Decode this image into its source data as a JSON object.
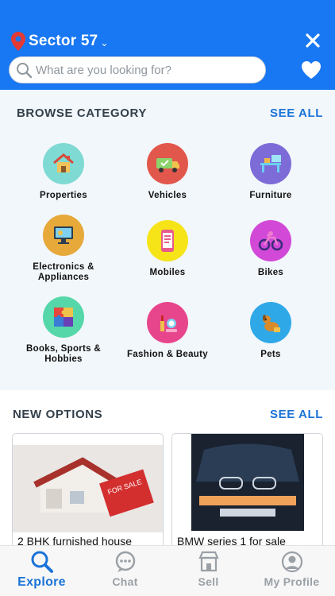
{
  "header": {
    "location": "Sector 57",
    "search_placeholder": "What are you looking for?",
    "pin_color": "#e53935",
    "bg_color": "#1877f2"
  },
  "browse": {
    "title": "BROWSE CATEGORY",
    "see_all": "SEE ALL",
    "categories": [
      {
        "label": "Properties",
        "icon": "house-icon",
        "color": "#7fdad3"
      },
      {
        "label": "Vehicles",
        "icon": "truck-icon",
        "color": "#e2574c"
      },
      {
        "label": "Furniture",
        "icon": "furniture-icon",
        "color": "#7d6bd8"
      },
      {
        "label": "Electronics &\nAppliances",
        "icon": "computer-icon",
        "color": "#e6a93a"
      },
      {
        "label": "Mobiles",
        "icon": "phone-icon",
        "color": "#f6e419"
      },
      {
        "label": "Bikes",
        "icon": "bike-icon",
        "color": "#d249d8"
      },
      {
        "label": "Books, Sports &\nHobbies",
        "icon": "puzzle-icon",
        "color": "#56d7a9"
      },
      {
        "label": "Fashion & Beauty",
        "icon": "cosmetics-icon",
        "color": "#e8468c"
      },
      {
        "label": "Pets",
        "icon": "dog-icon",
        "color": "#2fa8e8"
      }
    ]
  },
  "new_options": {
    "title": "NEW OPTIONS",
    "see_all": "SEE ALL",
    "items": [
      {
        "title": "2 BHK furnished house",
        "image": "house-for-sale-image",
        "sign_text": "FOR SALE"
      },
      {
        "title": "BMW series 1 for sale",
        "image": "bmw-car-image"
      }
    ]
  },
  "tabbar": {
    "tabs": [
      {
        "label": "Explore",
        "icon": "search-icon",
        "active": true
      },
      {
        "label": "Chat",
        "icon": "chat-icon",
        "active": false
      },
      {
        "label": "Sell",
        "icon": "store-icon",
        "active": false
      },
      {
        "label": "My Profile",
        "icon": "profile-icon",
        "active": false
      }
    ]
  }
}
